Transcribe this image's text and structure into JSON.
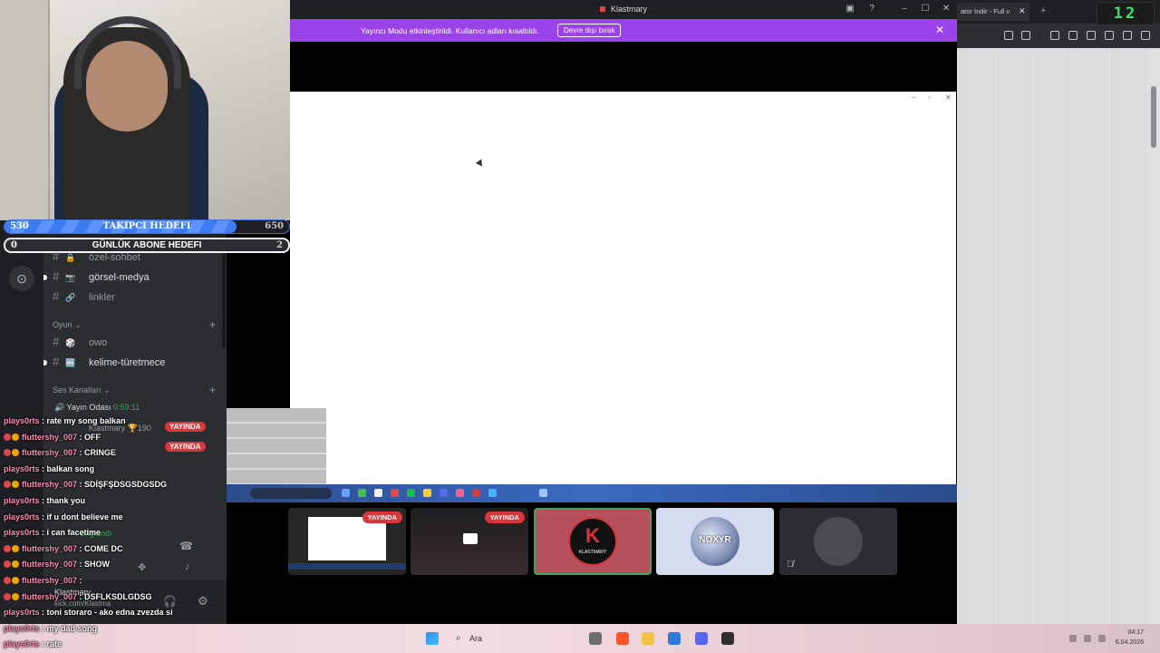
{
  "overlay": {
    "follower_goal": {
      "label": "TAKIPCI HEDEFI",
      "current": "530",
      "target": "650",
      "progress": 0.815
    },
    "sub_goal": {
      "label": "GÜNLÜK ABONE HEDEFI",
      "current": "0",
      "target": "2",
      "progress": 0
    }
  },
  "discord": {
    "channels": [
      {
        "name": "özel-sohbet",
        "emoji": "🔒"
      },
      {
        "name": "görsel-medya",
        "emoji": "📷"
      },
      {
        "name": "linkler",
        "emoji": "🔗"
      }
    ],
    "categories": {
      "game": "Oyun",
      "voice": "Ses Kanalları"
    },
    "game_channels": [
      {
        "name": "owo",
        "emoji": "🎲"
      },
      {
        "name": "kelime-türetmece",
        "emoji": "🔤"
      }
    ],
    "voice_channel": {
      "name": "Yayın Odası",
      "timer": "0:59:11"
    },
    "voice_users": [
      {
        "name": "Klastmary",
        "extra": "190",
        "live": "YAYINDA"
      },
      {
        "name": "",
        "live": "YAYINDA"
      }
    ],
    "voice_status": "Bağlandı",
    "panel_name": "Klastmary",
    "panel_sub": "kick.com/Klastma"
  },
  "chat": [
    {
      "user": "plays0rts",
      "text": "rate my song balkan",
      "badges": 0
    },
    {
      "user": "fluttershy_007",
      "text": "OFF",
      "badges": 2
    },
    {
      "user": "fluttershy_007",
      "text": "CRINGE",
      "badges": 2
    },
    {
      "user": "plays0rts",
      "text": "balkan song",
      "badges": 0
    },
    {
      "user": "fluttershy_007",
      "text": "SDİŞFŞDSGSDGSDG",
      "badges": 2
    },
    {
      "user": "plays0rts",
      "text": "thank you",
      "badges": 0
    },
    {
      "user": "plays0rts",
      "text": "if u dont believe me",
      "badges": 0
    },
    {
      "user": "plays0rts",
      "text": "i can facetime",
      "badges": 0
    },
    {
      "user": "fluttershy_007",
      "text": "COME DC",
      "badges": 2
    },
    {
      "user": "fluttershy_007",
      "text": "SHOW",
      "badges": 2
    },
    {
      "user": "fluttershy_007",
      "text": "",
      "badges": 2
    },
    {
      "user": "fluttershy_007",
      "text": "DSFLKSDLGDSG",
      "badges": 2
    },
    {
      "user": "plays0rts",
      "text": "toni storaro - ako edna zvezda si",
      "badges": 0
    },
    {
      "user": "plays0rts",
      "text": "my dad song",
      "badges": 0
    },
    {
      "user": "plays0rts",
      "text": "rate",
      "badges": 0
    }
  ],
  "window": {
    "title": "Klastmary",
    "banner_text": "Yayıncı Modu etkinleştirildi. Kullanıcı adları kısaltıldı.",
    "banner_button": "Devre dışı bırak"
  },
  "tiles": [
    {
      "live": "YAYINDA"
    },
    {
      "live": "YAYINDA"
    },
    {
      "logo_text": "K",
      "logo_sub": "KLASTMARY"
    },
    {
      "logo_text": "NOXYR"
    },
    {}
  ],
  "browser": {
    "tab_title": "ator İndir - Full v",
    "clock": "12"
  },
  "taskbar": {
    "search": "Ara",
    "time": "04:17",
    "date": "6.04.2026"
  },
  "colors": {
    "banner": "#9c42eb",
    "live": "#da373c",
    "goal_fill": "#3d7bf0",
    "clock": "#3ee26a"
  }
}
